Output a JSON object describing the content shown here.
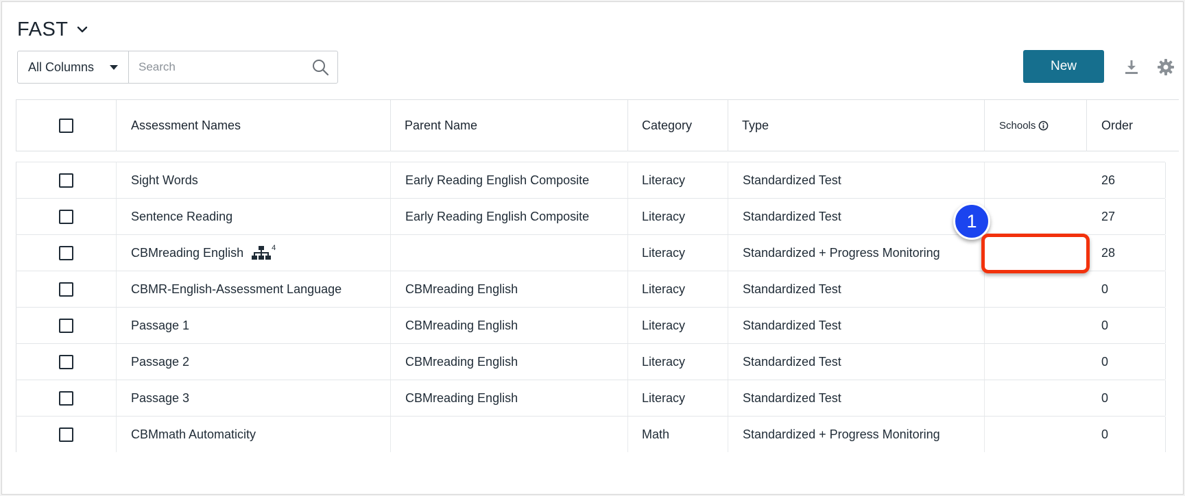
{
  "header": {
    "title": "FAST"
  },
  "filter": {
    "column_select": "All Columns",
    "search_placeholder": "Search",
    "search_value": ""
  },
  "toolbar": {
    "new_label": "New"
  },
  "table": {
    "columns": {
      "assessment_names": "Assessment Names",
      "parent_name": "Parent Name",
      "category": "Category",
      "type": "Type",
      "schools": "Schools",
      "order": "Order"
    },
    "rows": [
      {
        "name": "Sight Words",
        "parent": "Early Reading English Composite",
        "category": "Literacy",
        "type": "Standardized Test",
        "schools": "",
        "order": "26"
      },
      {
        "name": "Sentence Reading",
        "parent": "Early Reading English Composite",
        "category": "Literacy",
        "type": "Standardized Test",
        "schools": "",
        "order": "27"
      },
      {
        "name": "CBMreading English",
        "parent": "",
        "category": "Literacy",
        "type": "Standardized + Progress Monitoring",
        "schools": "",
        "order": "28",
        "child_count": "4"
      },
      {
        "name": "CBMR-English-Assessment Language",
        "parent": "CBMreading English",
        "category": "Literacy",
        "type": "Standardized Test",
        "schools": "",
        "order": "0"
      },
      {
        "name": "Passage 1",
        "parent": "CBMreading English",
        "category": "Literacy",
        "type": "Standardized Test",
        "schools": "",
        "order": "0"
      },
      {
        "name": "Passage 2",
        "parent": "CBMreading English",
        "category": "Literacy",
        "type": "Standardized Test",
        "schools": "",
        "order": "0"
      },
      {
        "name": "Passage 3",
        "parent": "CBMreading English",
        "category": "Literacy",
        "type": "Standardized Test",
        "schools": "",
        "order": "0"
      },
      {
        "name": "CBMmath Automaticity",
        "parent": "",
        "category": "Math",
        "type": "Standardized + Progress Monitoring",
        "schools": "",
        "order": "0"
      }
    ]
  },
  "annotation": {
    "step_number": "1"
  },
  "colors": {
    "accent": "#166f8e",
    "step_badge": "#1b44ef",
    "highlight": "#f2320c"
  }
}
